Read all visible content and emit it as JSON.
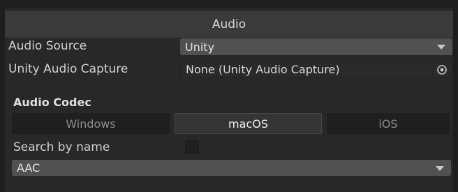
{
  "header": {
    "title": "Audio"
  },
  "audio_source": {
    "label": "Audio Source",
    "value": "Unity"
  },
  "audio_capture": {
    "label": "Unity Audio Capture",
    "value": "None (Unity Audio Capture)"
  },
  "codec_section": {
    "title": "Audio Codec",
    "tabs": [
      "Windows",
      "macOS",
      "iOS"
    ],
    "selected_tab": "macOS"
  },
  "search": {
    "label": "Search by name",
    "checked": false
  },
  "codec": {
    "value": "AAC"
  }
}
